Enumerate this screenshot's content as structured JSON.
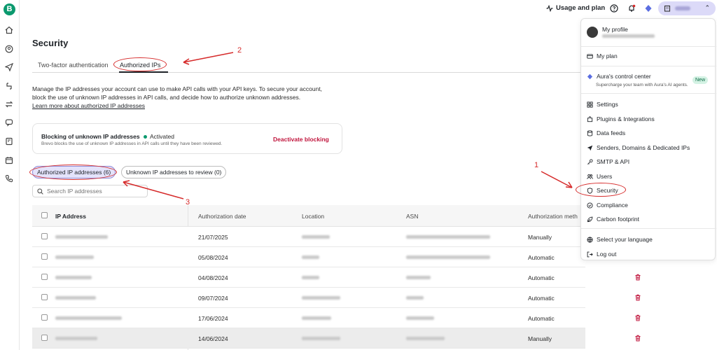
{
  "topbar": {
    "usage_label": "Usage and plan"
  },
  "page": {
    "title": "Security",
    "tabs": [
      {
        "label": "Two-factor authentication"
      },
      {
        "label": "Authorized IPs"
      }
    ],
    "intro_line1": "Manage the IP addresses your account can use to make API calls with your API keys. To secure your account,",
    "intro_line2": "block the use of unknown IP addresses in API calls, and decide how to authorize unknown addresses.",
    "intro_link": "Learn more about authorized IP addresses"
  },
  "blocking": {
    "title": "Blocking of unknown IP addresses",
    "status": "Activated",
    "subtitle": "Brevo blocks the use of unknown IP addresses in API calls until they have been reviewed.",
    "action": "Deactivate blocking"
  },
  "filters": {
    "authorized": "Authorized IP addresses (6)",
    "unknown": "Unknown IP addresses to review (0)"
  },
  "search": {
    "placeholder": "Search IP addresses"
  },
  "table": {
    "headers": {
      "ip": "IP Address",
      "date": "Authorization date",
      "location": "Location",
      "asn": "ASN",
      "method": "Authorization meth"
    },
    "rows": [
      {
        "date": "21/07/2025",
        "method": "Manually"
      },
      {
        "date": "05/08/2024",
        "method": "Automatic"
      },
      {
        "date": "04/08/2024",
        "method": "Automatic"
      },
      {
        "date": "09/07/2024",
        "method": "Automatic"
      },
      {
        "date": "17/06/2024",
        "method": "Automatic"
      },
      {
        "date": "14/06/2024",
        "method": "Manually"
      }
    ]
  },
  "menu": {
    "profile": "My profile",
    "plan": "My plan",
    "aura": "Aura's control center",
    "aura_sub": "Supercharge your team with Aura's AI agents.",
    "new_badge": "New",
    "settings": "Settings",
    "plugins": "Plugins & Integrations",
    "feeds": "Data feeds",
    "senders": "Senders, Domains & Dedicated IPs",
    "smtp": "SMTP & API",
    "users": "Users",
    "security": "Security",
    "compliance": "Compliance",
    "carbon": "Carbon footprint",
    "language": "Select your language",
    "logout": "Log out"
  },
  "annotations": {
    "n1": "1",
    "n2": "2",
    "n3": "3"
  },
  "colors": {
    "brand": "#0b996e",
    "danger": "#c0143c",
    "annotation": "#d62b2b",
    "pill_active": "#e4e3fb"
  }
}
